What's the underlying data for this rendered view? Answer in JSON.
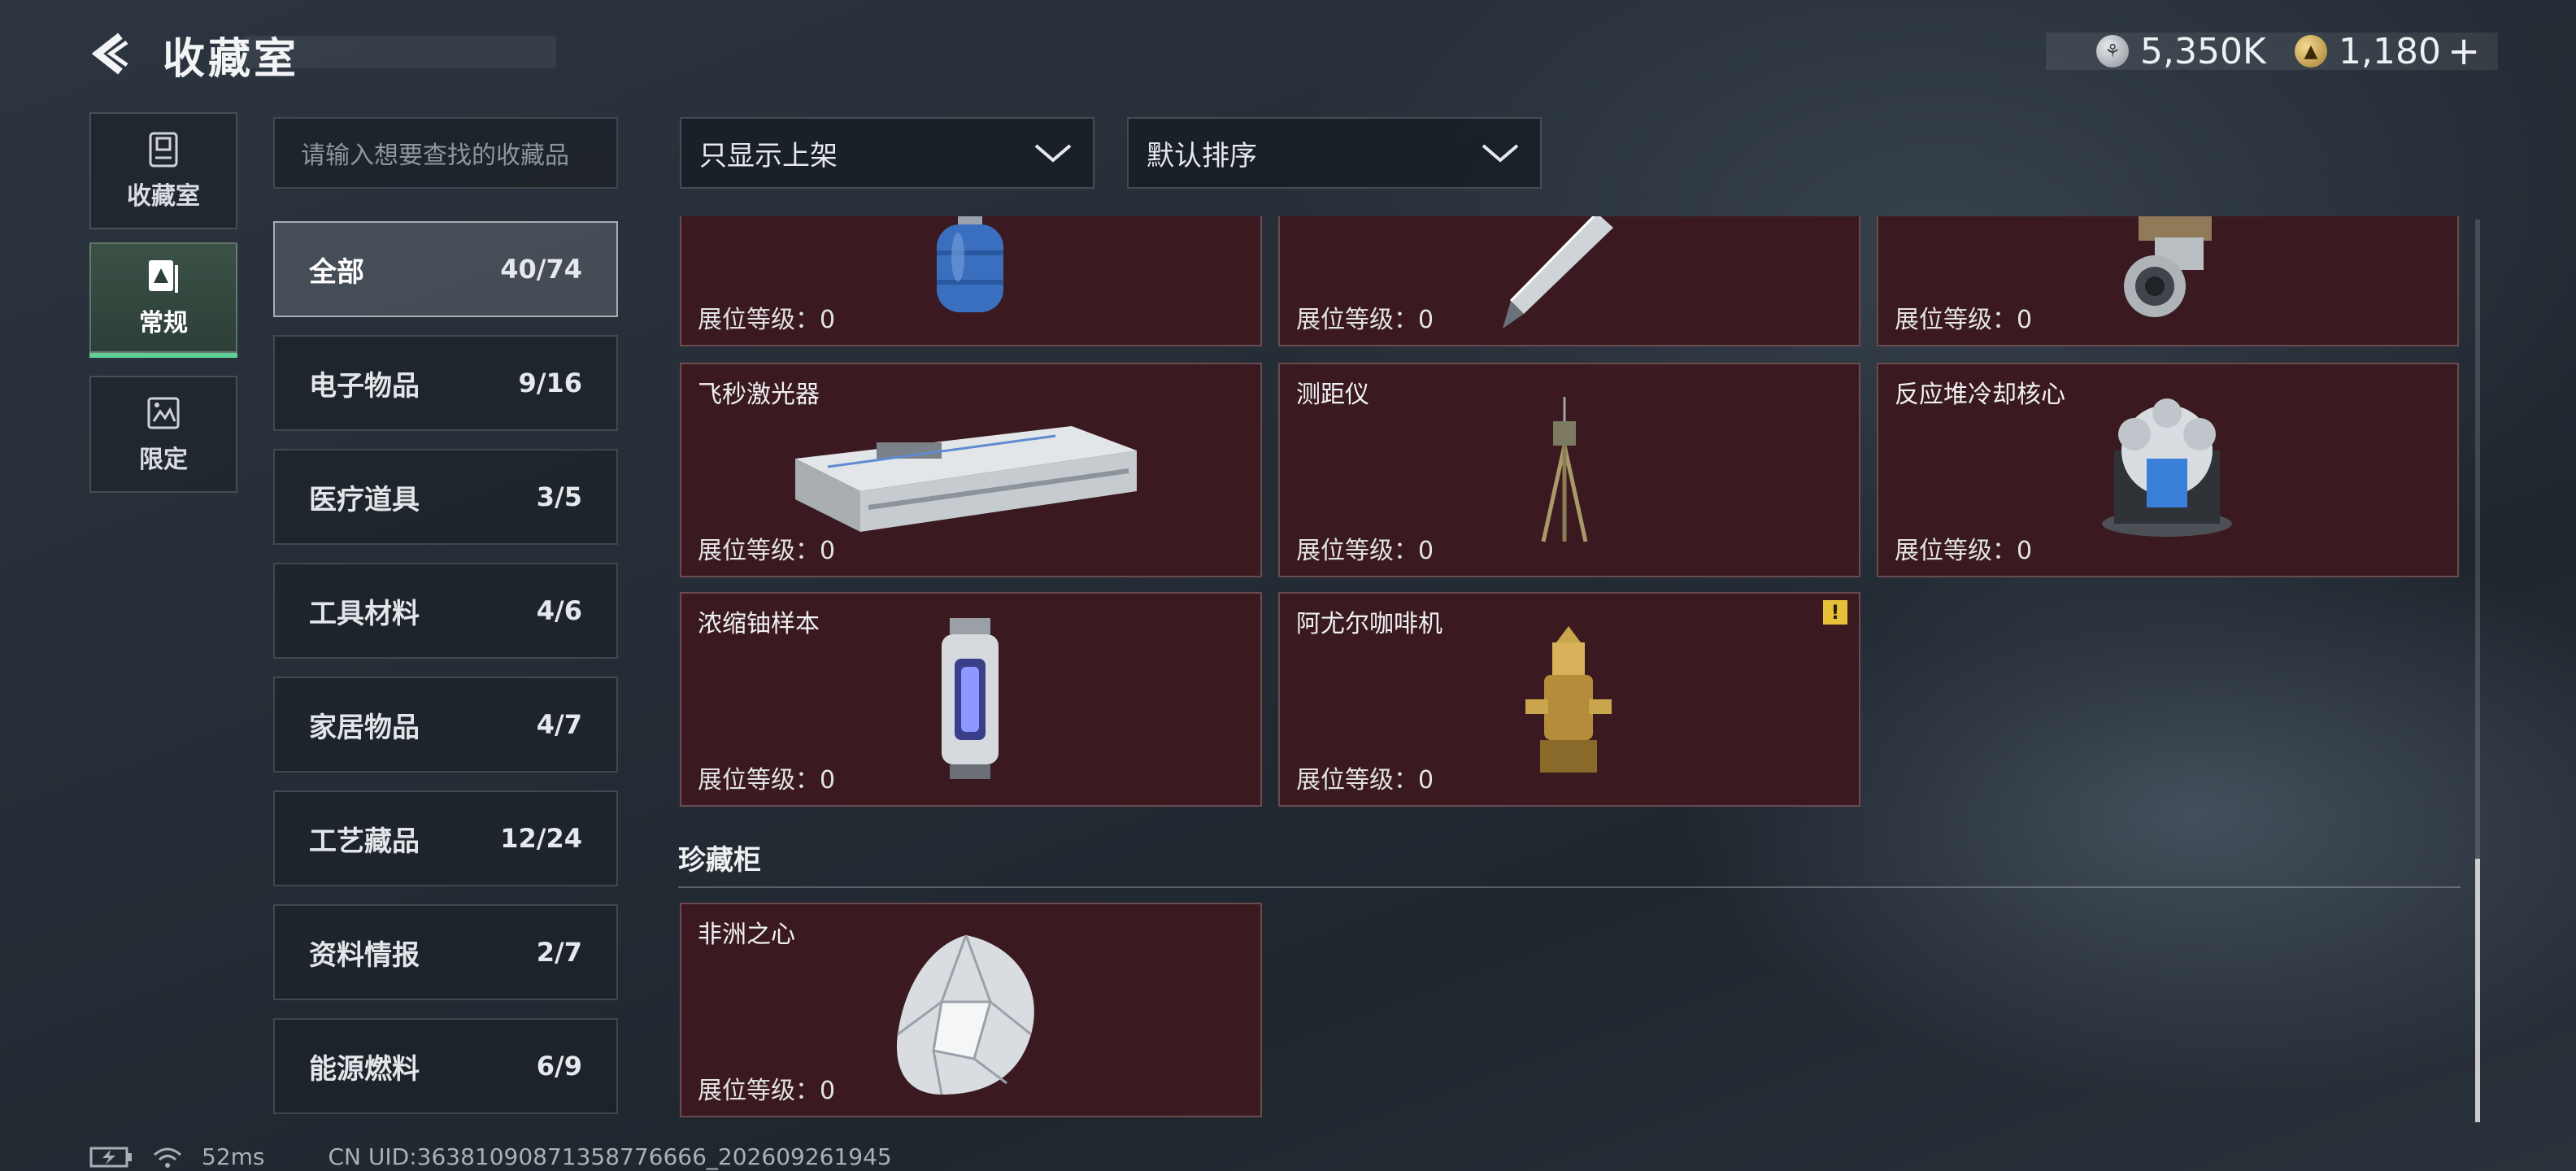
{
  "header": {
    "title": "收藏室",
    "currency": [
      {
        "icon": "silver-coin-icon",
        "value": "5,350K"
      },
      {
        "icon": "gold-coin-icon",
        "value": "1,180"
      }
    ],
    "add_symbol": "+"
  },
  "left_nav": [
    {
      "label": "收藏室",
      "icon": "vault-icon",
      "active": false
    },
    {
      "label": "常规",
      "icon": "regular-collection-icon",
      "active": true
    },
    {
      "label": "限定",
      "icon": "limited-collection-icon",
      "active": false
    }
  ],
  "search": {
    "placeholder": "请输入想要查找的收藏品"
  },
  "categories": [
    {
      "label": "全部",
      "count": "40/74",
      "active": true
    },
    {
      "label": "电子物品",
      "count": "9/16"
    },
    {
      "label": "医疗道具",
      "count": "3/5"
    },
    {
      "label": "工具材料",
      "count": "4/6"
    },
    {
      "label": "家居物品",
      "count": "4/7"
    },
    {
      "label": "工艺藏品",
      "count": "12/24"
    },
    {
      "label": "资料情报",
      "count": "2/7"
    },
    {
      "label": "能源燃料",
      "count": "6/9"
    }
  ],
  "filters": {
    "display": "只显示上架",
    "sort": "默认排序"
  },
  "level_label": "展位等级：0",
  "items": [
    {
      "name": "",
      "icon": "gas-canister-icon"
    },
    {
      "name": "",
      "icon": "pen-icon"
    },
    {
      "name": "",
      "icon": "mechanical-part-icon"
    },
    {
      "name": "飞秒激光器",
      "icon": "laser-device-icon"
    },
    {
      "name": "测距仪",
      "icon": "rangefinder-tripod-icon"
    },
    {
      "name": "反应堆冷却核心",
      "icon": "reactor-core-icon"
    },
    {
      "name": "浓缩铀样本",
      "icon": "uranium-capsule-icon"
    },
    {
      "name": "阿尤尔咖啡机",
      "icon": "coffee-machine-icon",
      "warning": "!"
    }
  ],
  "treasure_section": {
    "title": "珍藏柜",
    "items": [
      {
        "name": "非洲之心",
        "icon": "diamond-icon"
      }
    ]
  },
  "footer": {
    "ping": "52ms",
    "uid": "CN UID:36381090871358776666_202609261945"
  }
}
